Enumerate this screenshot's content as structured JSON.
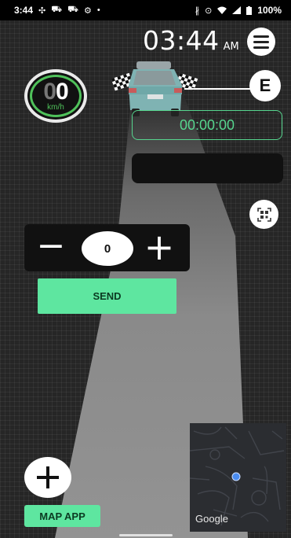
{
  "status_bar": {
    "time": "3:44",
    "battery": "100%",
    "left_icons": [
      "grid-icon",
      "car-icon",
      "car-icon",
      "gear-icon",
      "dot-icon"
    ],
    "right_icons": [
      "bluetooth-icon",
      "location-icon",
      "wifi-icon",
      "signal-icon",
      "battery-icon"
    ]
  },
  "clock": {
    "time": "03:44",
    "ampm": "AM"
  },
  "speedometer": {
    "ghost_digit": "0",
    "value": "0",
    "unit": "km/h"
  },
  "end_badge": {
    "label": "E"
  },
  "timer": {
    "value": "00:00:00"
  },
  "stepper": {
    "minus": "−",
    "value": "0",
    "plus": "+"
  },
  "send_button": {
    "label": "SEND"
  },
  "map_app_button": {
    "label": "MAP APP"
  },
  "map": {
    "logo": "Google"
  },
  "colors": {
    "accent_green": "#5ee6a0",
    "timer_green": "#57d68f",
    "speedo_ring": "#4fc15a",
    "location_dot": "#4a8cf0"
  }
}
